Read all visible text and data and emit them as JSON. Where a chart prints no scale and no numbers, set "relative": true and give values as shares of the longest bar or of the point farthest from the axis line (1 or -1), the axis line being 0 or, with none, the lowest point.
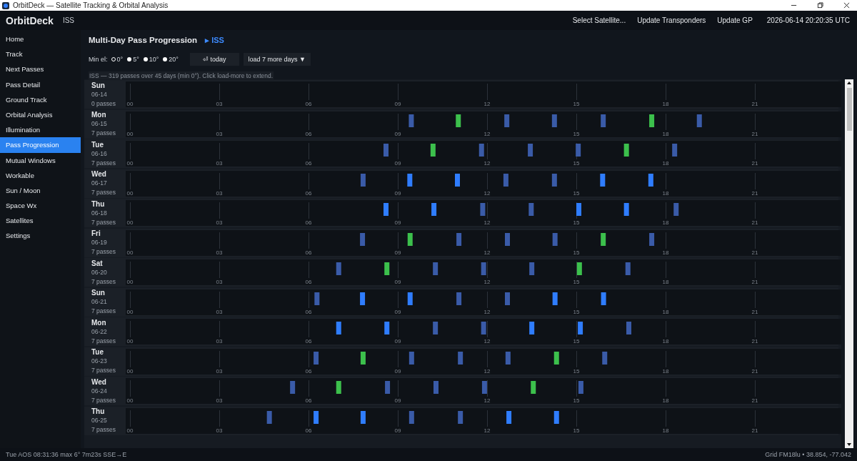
{
  "window": {
    "title": "OrbitDeck — Satellite Tracking & Orbital Analysis"
  },
  "header": {
    "app_name": "OrbitDeck",
    "satellite": "ISS",
    "actions": [
      "Select Satellite...",
      "Update Transponders",
      "Update GP"
    ],
    "clock": "2026-06-14  20:20:35 UTC"
  },
  "sidebar": {
    "items": [
      {
        "label": "Home",
        "selected": false
      },
      {
        "label": "Track",
        "selected": false
      },
      {
        "label": "Next Passes",
        "selected": false
      },
      {
        "label": "Pass Detail",
        "selected": false
      },
      {
        "label": "Ground Track",
        "selected": false
      },
      {
        "label": "Orbital Analysis",
        "selected": false
      },
      {
        "label": "Illumination",
        "selected": false
      },
      {
        "label": "Pass Progression",
        "selected": true
      },
      {
        "label": "Mutual Windows",
        "selected": false
      },
      {
        "label": "Workable",
        "selected": false
      },
      {
        "label": "Sun / Moon",
        "selected": false
      },
      {
        "label": "Space Wx",
        "selected": false
      },
      {
        "label": "Satellites",
        "selected": false
      },
      {
        "label": "Settings",
        "selected": false
      }
    ]
  },
  "page": {
    "title": "Multi-Day Pass Progression",
    "satellite_link": "▸ ISS",
    "min_el_label": "Min el:",
    "min_el_options": [
      {
        "label": "0°",
        "selected": true
      },
      {
        "label": "5°",
        "selected": false
      },
      {
        "label": "10°",
        "selected": false
      },
      {
        "label": "20°",
        "selected": false
      }
    ],
    "today_button": "⏎ today",
    "load_button": "load 7 more days ▼",
    "summary": "ISS — 319 passes over 45 days (min 0°). Click load-more to extend."
  },
  "days": [
    {
      "weekday": "Sun",
      "date": "06-14",
      "count": "0 passes",
      "hour_ticks": [
        "00",
        "03",
        "06",
        "09",
        "12",
        "15",
        "18",
        "21"
      ]
    },
    {
      "weekday": "Mon",
      "date": "06-15",
      "count": "7 passes",
      "chart_data": {
        "type": "bar",
        "relative": true,
        "grid": true,
        "xlim": [
          0,
          24
        ],
        "xticks": [
          {
            "value": 0,
            "label": "00"
          },
          {
            "value": 3,
            "label": "03"
          },
          {
            "value": 6,
            "label": "06"
          },
          {
            "value": 9,
            "label": "09"
          },
          {
            "value": 12,
            "label": "12"
          },
          {
            "value": 15,
            "label": "15"
          },
          {
            "value": 18,
            "label": "18"
          },
          {
            "value": 21,
            "label": "21"
          }
        ],
        "series": [
          {
            "color": "#3a5ba8",
            "x": [
              9.37,
              12.58,
              14.18,
              15.82,
              19.05
            ],
            "values": [
              1,
              1,
              1,
              1,
              1
            ]
          },
          {
            "color": "#3cc04c",
            "x": [
              10.95,
              17.45
            ],
            "values": [
              1,
              1
            ]
          }
        ]
      }
    },
    {
      "weekday": "Tue",
      "date": "06-16",
      "count": "7 passes",
      "chart_data": {
        "type": "bar",
        "relative": true,
        "grid": true,
        "xlim": [
          0,
          24
        ],
        "xticks": [
          {
            "value": 0,
            "label": "00"
          },
          {
            "value": 3,
            "label": "03"
          },
          {
            "value": 6,
            "label": "06"
          },
          {
            "value": 9,
            "label": "09"
          },
          {
            "value": 12,
            "label": "12"
          },
          {
            "value": 15,
            "label": "15"
          },
          {
            "value": 18,
            "label": "18"
          },
          {
            "value": 21,
            "label": "21"
          }
        ],
        "series": [
          {
            "color": "#3a5ba8",
            "x": [
              8.52,
              11.73,
              13.37,
              14.98,
              18.22
            ],
            "values": [
              1,
              1,
              1,
              1,
              1
            ]
          },
          {
            "color": "#3cc04c",
            "x": [
              10.1,
              16.6
            ],
            "values": [
              1,
              1
            ]
          }
        ]
      }
    },
    {
      "weekday": "Wed",
      "date": "06-17",
      "count": "7 passes",
      "chart_data": {
        "type": "bar",
        "relative": true,
        "grid": true,
        "xlim": [
          0,
          24
        ],
        "xticks": [
          {
            "value": 0,
            "label": "00"
          },
          {
            "value": 3,
            "label": "03"
          },
          {
            "value": 6,
            "label": "06"
          },
          {
            "value": 9,
            "label": "09"
          },
          {
            "value": 12,
            "label": "12"
          },
          {
            "value": 15,
            "label": "15"
          },
          {
            "value": 18,
            "label": "18"
          },
          {
            "value": 21,
            "label": "21"
          }
        ],
        "series": [
          {
            "color": "#3a5ba8",
            "x": [
              7.75,
              12.55,
              14.18
            ],
            "values": [
              1,
              1,
              1
            ]
          },
          {
            "color": "#2f7dff",
            "x": [
              9.32,
              10.92,
              15.8,
              17.42
            ],
            "values": [
              1,
              1,
              1,
              1
            ]
          }
        ]
      }
    },
    {
      "weekday": "Thu",
      "date": "06-18",
      "count": "7 passes",
      "chart_data": {
        "type": "bar",
        "relative": true,
        "grid": true,
        "xlim": [
          0,
          24
        ],
        "xticks": [
          {
            "value": 0,
            "label": "00"
          },
          {
            "value": 3,
            "label": "03"
          },
          {
            "value": 6,
            "label": "06"
          },
          {
            "value": 9,
            "label": "09"
          },
          {
            "value": 12,
            "label": "12"
          },
          {
            "value": 15,
            "label": "15"
          },
          {
            "value": 18,
            "label": "18"
          },
          {
            "value": 21,
            "label": "21"
          }
        ],
        "series": [
          {
            "color": "#3a5ba8",
            "x": [
              11.77,
              13.4,
              18.27
            ],
            "values": [
              1,
              1,
              1
            ]
          },
          {
            "color": "#2f7dff",
            "x": [
              8.52,
              10.13,
              15.0,
              16.6
            ],
            "values": [
              1,
              1,
              1,
              1
            ]
          }
        ]
      }
    },
    {
      "weekday": "Fri",
      "date": "06-19",
      "count": "7 passes",
      "chart_data": {
        "type": "bar",
        "relative": true,
        "grid": true,
        "xlim": [
          0,
          24
        ],
        "xticks": [
          {
            "value": 0,
            "label": "00"
          },
          {
            "value": 3,
            "label": "03"
          },
          {
            "value": 6,
            "label": "06"
          },
          {
            "value": 9,
            "label": "09"
          },
          {
            "value": 12,
            "label": "12"
          },
          {
            "value": 15,
            "label": "15"
          },
          {
            "value": 18,
            "label": "18"
          },
          {
            "value": 21,
            "label": "21"
          }
        ],
        "series": [
          {
            "color": "#3a5ba8",
            "x": [
              7.73,
              10.97,
              12.6,
              14.2,
              17.45
            ],
            "values": [
              1,
              1,
              1,
              1,
              1
            ]
          },
          {
            "color": "#3cc04c",
            "x": [
              9.33,
              15.82
            ],
            "values": [
              1,
              1
            ]
          }
        ]
      }
    },
    {
      "weekday": "Sat",
      "date": "06-20",
      "count": "7 passes",
      "chart_data": {
        "type": "bar",
        "relative": true,
        "grid": true,
        "xlim": [
          0,
          24
        ],
        "xticks": [
          {
            "value": 0,
            "label": "00"
          },
          {
            "value": 3,
            "label": "03"
          },
          {
            "value": 6,
            "label": "06"
          },
          {
            "value": 9,
            "label": "09"
          },
          {
            "value": 12,
            "label": "12"
          },
          {
            "value": 15,
            "label": "15"
          },
          {
            "value": 18,
            "label": "18"
          },
          {
            "value": 21,
            "label": "21"
          }
        ],
        "series": [
          {
            "color": "#3a5ba8",
            "x": [
              6.93,
              10.18,
              11.8,
              13.42,
              16.65
            ],
            "values": [
              1,
              1,
              1,
              1,
              1
            ]
          },
          {
            "color": "#3cc04c",
            "x": [
              8.55,
              15.02
            ],
            "values": [
              1,
              1
            ]
          }
        ]
      }
    },
    {
      "weekday": "Sun",
      "date": "06-21",
      "count": "7 passes",
      "chart_data": {
        "type": "bar",
        "relative": true,
        "grid": true,
        "xlim": [
          0,
          24
        ],
        "xticks": [
          {
            "value": 0,
            "label": "00"
          },
          {
            "value": 3,
            "label": "03"
          },
          {
            "value": 6,
            "label": "06"
          },
          {
            "value": 9,
            "label": "09"
          },
          {
            "value": 12,
            "label": "12"
          },
          {
            "value": 15,
            "label": "15"
          },
          {
            "value": 18,
            "label": "18"
          },
          {
            "value": 21,
            "label": "21"
          }
        ],
        "series": [
          {
            "color": "#3a5ba8",
            "x": [
              6.2,
              10.97,
              12.6
            ],
            "values": [
              1,
              1,
              1
            ]
          },
          {
            "color": "#2f7dff",
            "x": [
              7.73,
              9.33,
              14.2,
              15.83
            ],
            "values": [
              1,
              1,
              1,
              1
            ]
          }
        ]
      }
    },
    {
      "weekday": "Mon",
      "date": "06-22",
      "count": "7 passes",
      "chart_data": {
        "type": "bar",
        "relative": true,
        "grid": true,
        "xlim": [
          0,
          24
        ],
        "xticks": [
          {
            "value": 0,
            "label": "00"
          },
          {
            "value": 3,
            "label": "03"
          },
          {
            "value": 6,
            "label": "06"
          },
          {
            "value": 9,
            "label": "09"
          },
          {
            "value": 12,
            "label": "12"
          },
          {
            "value": 15,
            "label": "15"
          },
          {
            "value": 18,
            "label": "18"
          },
          {
            "value": 21,
            "label": "21"
          }
        ],
        "series": [
          {
            "color": "#3a5ba8",
            "x": [
              10.18,
              11.8,
              16.68
            ],
            "values": [
              1,
              1,
              1
            ]
          },
          {
            "color": "#2f7dff",
            "x": [
              6.93,
              8.55,
              13.42,
              15.05
            ],
            "values": [
              1,
              1,
              1,
              1
            ]
          }
        ]
      }
    },
    {
      "weekday": "Tue",
      "date": "06-23",
      "count": "7 passes",
      "chart_data": {
        "type": "bar",
        "relative": true,
        "grid": true,
        "xlim": [
          0,
          24
        ],
        "xticks": [
          {
            "value": 0,
            "label": "00"
          },
          {
            "value": 3,
            "label": "03"
          },
          {
            "value": 6,
            "label": "06"
          },
          {
            "value": 9,
            "label": "09"
          },
          {
            "value": 12,
            "label": "12"
          },
          {
            "value": 15,
            "label": "15"
          },
          {
            "value": 18,
            "label": "18"
          },
          {
            "value": 21,
            "label": "21"
          }
        ],
        "series": [
          {
            "color": "#3a5ba8",
            "x": [
              6.17,
              9.38,
              11.02,
              12.62,
              15.87
            ],
            "values": [
              1,
              1,
              1,
              1,
              1
            ]
          },
          {
            "color": "#3cc04c",
            "x": [
              7.75,
              14.25
            ],
            "values": [
              1,
              1
            ]
          }
        ]
      }
    },
    {
      "weekday": "Wed",
      "date": "06-24",
      "count": "7 passes",
      "chart_data": {
        "type": "bar",
        "relative": true,
        "grid": true,
        "xlim": [
          0,
          24
        ],
        "xticks": [
          {
            "value": 0,
            "label": "00"
          },
          {
            "value": 3,
            "label": "03"
          },
          {
            "value": 6,
            "label": "06"
          },
          {
            "value": 9,
            "label": "09"
          },
          {
            "value": 12,
            "label": "12"
          },
          {
            "value": 15,
            "label": "15"
          },
          {
            "value": 18,
            "label": "18"
          },
          {
            "value": 21,
            "label": "21"
          }
        ],
        "series": [
          {
            "color": "#3a5ba8",
            "x": [
              5.38,
              8.57,
              10.2,
              11.83,
              15.07
            ],
            "values": [
              1,
              1,
              1,
              1,
              1
            ]
          },
          {
            "color": "#3cc04c",
            "x": [
              6.93,
              13.47
            ],
            "values": [
              1,
              1
            ]
          }
        ]
      }
    },
    {
      "weekday": "Thu",
      "date": "06-25",
      "count": "7 passes",
      "chart_data": {
        "type": "bar",
        "relative": true,
        "grid": true,
        "xlim": [
          0,
          24
        ],
        "xticks": [
          {
            "value": 0,
            "label": "00"
          },
          {
            "value": 3,
            "label": "03"
          },
          {
            "value": 6,
            "label": "06"
          },
          {
            "value": 9,
            "label": "09"
          },
          {
            "value": 12,
            "label": "12"
          },
          {
            "value": 15,
            "label": "15"
          },
          {
            "value": 18,
            "label": "18"
          },
          {
            "value": 21,
            "label": "21"
          }
        ],
        "series": [
          {
            "color": "#3a5ba8",
            "x": [
              4.6,
              9.38,
              11.02
            ],
            "values": [
              1,
              1,
              1
            ]
          },
          {
            "color": "#2f7dff",
            "x": [
              6.17,
              7.75,
              12.65,
              14.25
            ],
            "values": [
              1,
              1,
              1,
              1
            ]
          }
        ]
      }
    }
  ],
  "status_bar": {
    "left": "Tue  AOS 08:31:36  max 6°  7m23s  SSE→E",
    "right": "Grid FM18lu  •  38.854, -77.042"
  }
}
